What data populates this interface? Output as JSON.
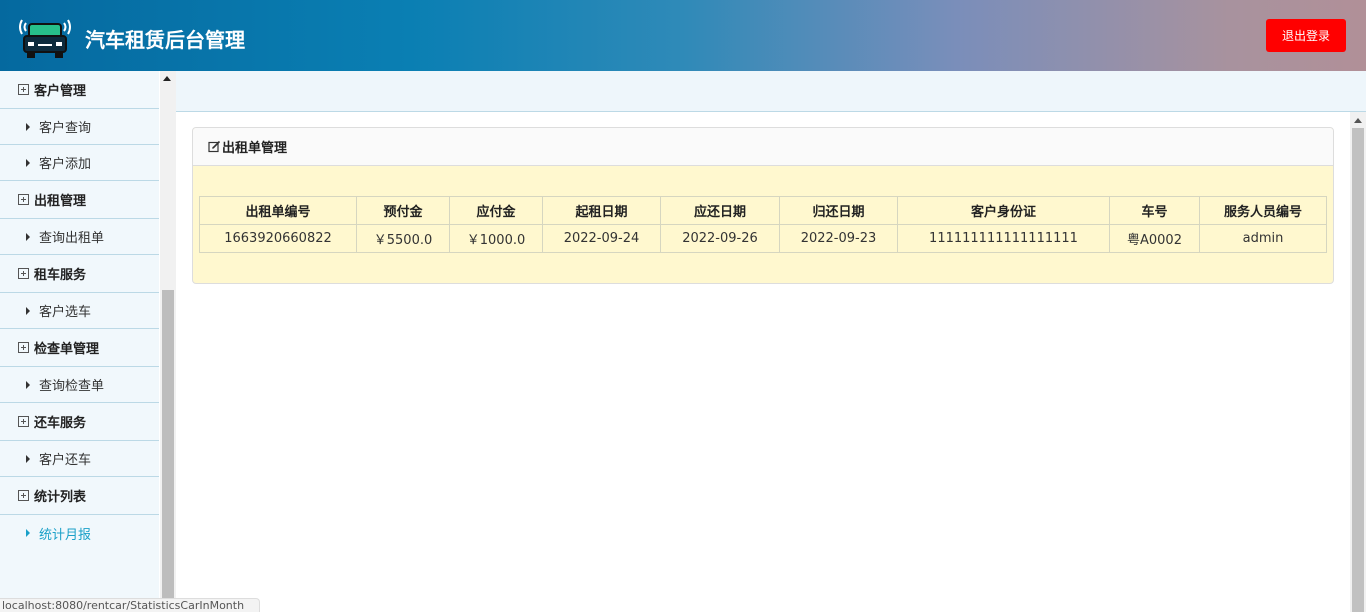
{
  "header": {
    "title": "汽车租赁后台管理",
    "logout_label": "退出登录",
    "logout_color": "#ff0000"
  },
  "sidebar": {
    "groups": [
      {
        "label": "客户管理",
        "items": [
          "客户查询",
          "客户添加"
        ]
      },
      {
        "label": "出租管理",
        "items": [
          "查询出租单"
        ]
      },
      {
        "label": "租车服务",
        "items": [
          "客户选车"
        ]
      },
      {
        "label": "检查单管理",
        "items": [
          "查询检查单"
        ]
      },
      {
        "label": "还车服务",
        "items": [
          "客户还车"
        ]
      },
      {
        "label": "统计列表",
        "items": [
          "统计月报"
        ]
      }
    ],
    "active_item": "统计月报",
    "active_color": "#1aa0c8"
  },
  "status_url": "localhost:8080/rentcar/StatisticsCarInMonth",
  "panel": {
    "title": "出租单管理",
    "columns": [
      "出租单编号",
      "预付金",
      "应付金",
      "起租日期",
      "应还日期",
      "归还日期",
      "客户身份证",
      "车号",
      "服务人员编号"
    ],
    "rows": [
      [
        "1663920660822",
        "￥5500.0",
        "￥1000.0",
        "2022-09-24",
        "2022-09-26",
        "2022-09-23",
        "111111111111111111",
        "粤A0002",
        "admin"
      ]
    ]
  }
}
